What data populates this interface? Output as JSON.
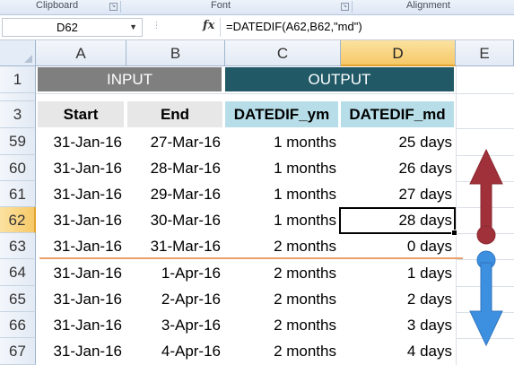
{
  "ribbon": {
    "sections": [
      "Clipboard",
      "Font",
      "Alignment"
    ]
  },
  "formula_bar": {
    "name_box": "D62",
    "fx_label": "fx",
    "formula": "=DATEDIF(A62,B62,\"md\")"
  },
  "columns": [
    "A",
    "B",
    "C",
    "D",
    "E"
  ],
  "active_column": "D",
  "active_row": "62",
  "banners": {
    "input": "INPUT",
    "output": "OUTPUT"
  },
  "row_numbers": {
    "banner": "1",
    "header": "3"
  },
  "headers": [
    "Start",
    "End",
    "DATEDIF_ym",
    "DATEDIF_md"
  ],
  "rows": [
    {
      "num": "59",
      "start": "31-Jan-16",
      "end": "27-Mar-16",
      "ym": "1 months",
      "md": "25 days"
    },
    {
      "num": "60",
      "start": "31-Jan-16",
      "end": "28-Mar-16",
      "ym": "1 months",
      "md": "26 days"
    },
    {
      "num": "61",
      "start": "31-Jan-16",
      "end": "29-Mar-16",
      "ym": "1 months",
      "md": "27 days"
    },
    {
      "num": "62",
      "start": "31-Jan-16",
      "end": "30-Mar-16",
      "ym": "1 months",
      "md": "28 days"
    },
    {
      "num": "63",
      "start": "31-Jan-16",
      "end": "31-Mar-16",
      "ym": "2 months",
      "md": "0 days"
    },
    {
      "num": "64",
      "start": "31-Jan-16",
      "end": "1-Apr-16",
      "ym": "2 months",
      "md": "1 days"
    },
    {
      "num": "65",
      "start": "31-Jan-16",
      "end": "2-Apr-16",
      "ym": "2 months",
      "md": "2 days"
    },
    {
      "num": "66",
      "start": "31-Jan-16",
      "end": "3-Apr-16",
      "ym": "2 months",
      "md": "3 days"
    },
    {
      "num": "67",
      "start": "31-Jan-16",
      "end": "4-Apr-16",
      "ym": "2 months",
      "md": "4 days"
    }
  ],
  "colors": {
    "input_banner": "#7f7f7f",
    "output_banner": "#215967",
    "input_header": "#e7e7e7",
    "output_header": "#b7dee8",
    "up_arrow": "#a0313a",
    "down_arrow": "#3d8fe0",
    "divider_line": "#e9a06b"
  },
  "annotations": {
    "up_arrow_icon": "arrow-up-icon",
    "down_arrow_icon": "arrow-down-icon"
  }
}
